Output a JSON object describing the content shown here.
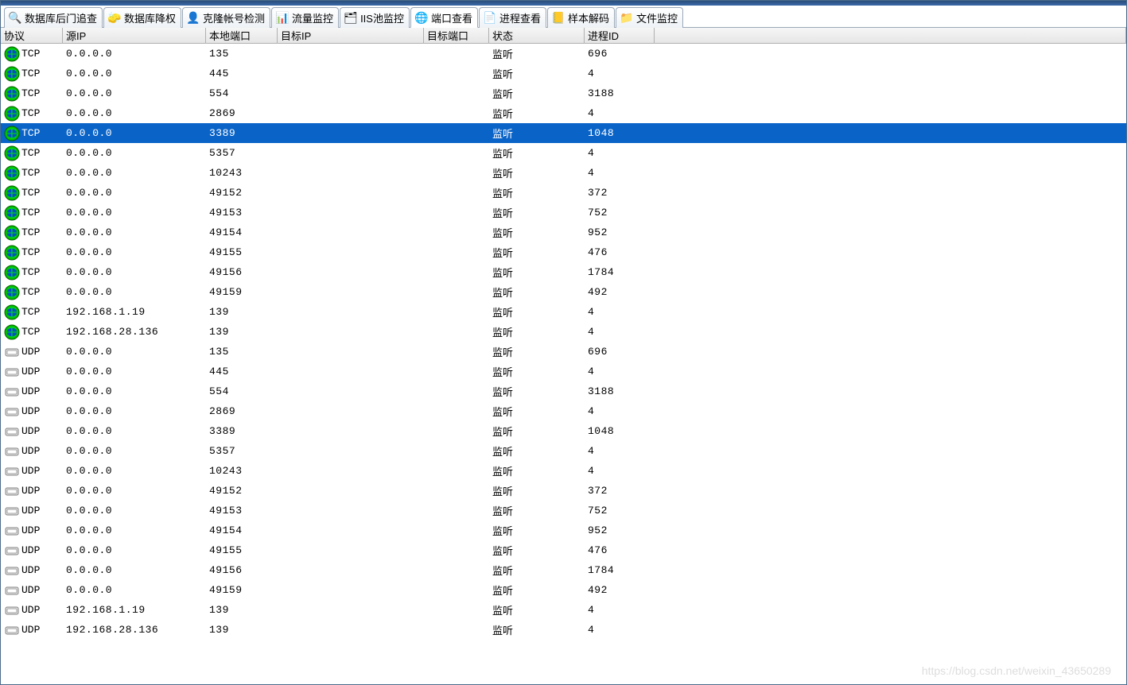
{
  "tabs": [
    {
      "label": "数据库后门追查",
      "icon": "db-icon",
      "icon_glyph": "🔍",
      "active": false
    },
    {
      "label": "数据库降权",
      "icon": "eraser-icon",
      "icon_glyph": "🧽",
      "active": false
    },
    {
      "label": "克隆帐号检测",
      "icon": "clone-icon",
      "icon_glyph": "👤",
      "active": false
    },
    {
      "label": "流量监控",
      "icon": "flow-icon",
      "icon_glyph": "📊",
      "active": false
    },
    {
      "label": "IIS池监控",
      "icon": "iis-icon",
      "icon_glyph": "🗂",
      "active": false
    },
    {
      "label": "端口查看",
      "icon": "port-icon",
      "icon_glyph": "🌐",
      "active": true
    },
    {
      "label": "进程查看",
      "icon": "proc-icon",
      "icon_glyph": "📄",
      "active": false
    },
    {
      "label": "样本解码",
      "icon": "sample-icon",
      "icon_glyph": "📒",
      "active": false
    },
    {
      "label": "文件监控",
      "icon": "file-icon",
      "icon_glyph": "📁",
      "active": false
    }
  ],
  "columns": {
    "protocol": "协议",
    "source_ip": "源IP",
    "local_port": "本地端口",
    "target_ip": "目标IP",
    "target_port": "目标端口",
    "state": "状态",
    "process_id": "进程ID"
  },
  "selected_row_index": 4,
  "rows": [
    {
      "protocol": "TCP",
      "source_ip": "0.0.0.0",
      "local_port": "135",
      "target_ip": "",
      "target_port": "",
      "state": "监听",
      "process_id": "696"
    },
    {
      "protocol": "TCP",
      "source_ip": "0.0.0.0",
      "local_port": "445",
      "target_ip": "",
      "target_port": "",
      "state": "监听",
      "process_id": "4"
    },
    {
      "protocol": "TCP",
      "source_ip": "0.0.0.0",
      "local_port": "554",
      "target_ip": "",
      "target_port": "",
      "state": "监听",
      "process_id": "3188"
    },
    {
      "protocol": "TCP",
      "source_ip": "0.0.0.0",
      "local_port": "2869",
      "target_ip": "",
      "target_port": "",
      "state": "监听",
      "process_id": "4"
    },
    {
      "protocol": "TCP",
      "source_ip": "0.0.0.0",
      "local_port": "3389",
      "target_ip": "",
      "target_port": "",
      "state": "监听",
      "process_id": "1048"
    },
    {
      "protocol": "TCP",
      "source_ip": "0.0.0.0",
      "local_port": "5357",
      "target_ip": "",
      "target_port": "",
      "state": "监听",
      "process_id": "4"
    },
    {
      "protocol": "TCP",
      "source_ip": "0.0.0.0",
      "local_port": "10243",
      "target_ip": "",
      "target_port": "",
      "state": "监听",
      "process_id": "4"
    },
    {
      "protocol": "TCP",
      "source_ip": "0.0.0.0",
      "local_port": "49152",
      "target_ip": "",
      "target_port": "",
      "state": "监听",
      "process_id": "372"
    },
    {
      "protocol": "TCP",
      "source_ip": "0.0.0.0",
      "local_port": "49153",
      "target_ip": "",
      "target_port": "",
      "state": "监听",
      "process_id": "752"
    },
    {
      "protocol": "TCP",
      "source_ip": "0.0.0.0",
      "local_port": "49154",
      "target_ip": "",
      "target_port": "",
      "state": "监听",
      "process_id": "952"
    },
    {
      "protocol": "TCP",
      "source_ip": "0.0.0.0",
      "local_port": "49155",
      "target_ip": "",
      "target_port": "",
      "state": "监听",
      "process_id": "476"
    },
    {
      "protocol": "TCP",
      "source_ip": "0.0.0.0",
      "local_port": "49156",
      "target_ip": "",
      "target_port": "",
      "state": "监听",
      "process_id": "1784"
    },
    {
      "protocol": "TCP",
      "source_ip": "0.0.0.0",
      "local_port": "49159",
      "target_ip": "",
      "target_port": "",
      "state": "监听",
      "process_id": "492"
    },
    {
      "protocol": "TCP",
      "source_ip": "192.168.1.19",
      "local_port": "139",
      "target_ip": "",
      "target_port": "",
      "state": "监听",
      "process_id": "4"
    },
    {
      "protocol": "TCP",
      "source_ip": "192.168.28.136",
      "local_port": "139",
      "target_ip": "",
      "target_port": "",
      "state": "监听",
      "process_id": "4"
    },
    {
      "protocol": "UDP",
      "source_ip": "0.0.0.0",
      "local_port": "135",
      "target_ip": "",
      "target_port": "",
      "state": "监听",
      "process_id": "696"
    },
    {
      "protocol": "UDP",
      "source_ip": "0.0.0.0",
      "local_port": "445",
      "target_ip": "",
      "target_port": "",
      "state": "监听",
      "process_id": "4"
    },
    {
      "protocol": "UDP",
      "source_ip": "0.0.0.0",
      "local_port": "554",
      "target_ip": "",
      "target_port": "",
      "state": "监听",
      "process_id": "3188"
    },
    {
      "protocol": "UDP",
      "source_ip": "0.0.0.0",
      "local_port": "2869",
      "target_ip": "",
      "target_port": "",
      "state": "监听",
      "process_id": "4"
    },
    {
      "protocol": "UDP",
      "source_ip": "0.0.0.0",
      "local_port": "3389",
      "target_ip": "",
      "target_port": "",
      "state": "监听",
      "process_id": "1048"
    },
    {
      "protocol": "UDP",
      "source_ip": "0.0.0.0",
      "local_port": "5357",
      "target_ip": "",
      "target_port": "",
      "state": "监听",
      "process_id": "4"
    },
    {
      "protocol": "UDP",
      "source_ip": "0.0.0.0",
      "local_port": "10243",
      "target_ip": "",
      "target_port": "",
      "state": "监听",
      "process_id": "4"
    },
    {
      "protocol": "UDP",
      "source_ip": "0.0.0.0",
      "local_port": "49152",
      "target_ip": "",
      "target_port": "",
      "state": "监听",
      "process_id": "372"
    },
    {
      "protocol": "UDP",
      "source_ip": "0.0.0.0",
      "local_port": "49153",
      "target_ip": "",
      "target_port": "",
      "state": "监听",
      "process_id": "752"
    },
    {
      "protocol": "UDP",
      "source_ip": "0.0.0.0",
      "local_port": "49154",
      "target_ip": "",
      "target_port": "",
      "state": "监听",
      "process_id": "952"
    },
    {
      "protocol": "UDP",
      "source_ip": "0.0.0.0",
      "local_port": "49155",
      "target_ip": "",
      "target_port": "",
      "state": "监听",
      "process_id": "476"
    },
    {
      "protocol": "UDP",
      "source_ip": "0.0.0.0",
      "local_port": "49156",
      "target_ip": "",
      "target_port": "",
      "state": "监听",
      "process_id": "1784"
    },
    {
      "protocol": "UDP",
      "source_ip": "0.0.0.0",
      "local_port": "49159",
      "target_ip": "",
      "target_port": "",
      "state": "监听",
      "process_id": "492"
    },
    {
      "protocol": "UDP",
      "source_ip": "192.168.1.19",
      "local_port": "139",
      "target_ip": "",
      "target_port": "",
      "state": "监听",
      "process_id": "4"
    },
    {
      "protocol": "UDP",
      "source_ip": "192.168.28.136",
      "local_port": "139",
      "target_ip": "",
      "target_port": "",
      "state": "监听",
      "process_id": "4"
    }
  ],
  "watermark": "https://blog.csdn.net/weixin_43650289"
}
